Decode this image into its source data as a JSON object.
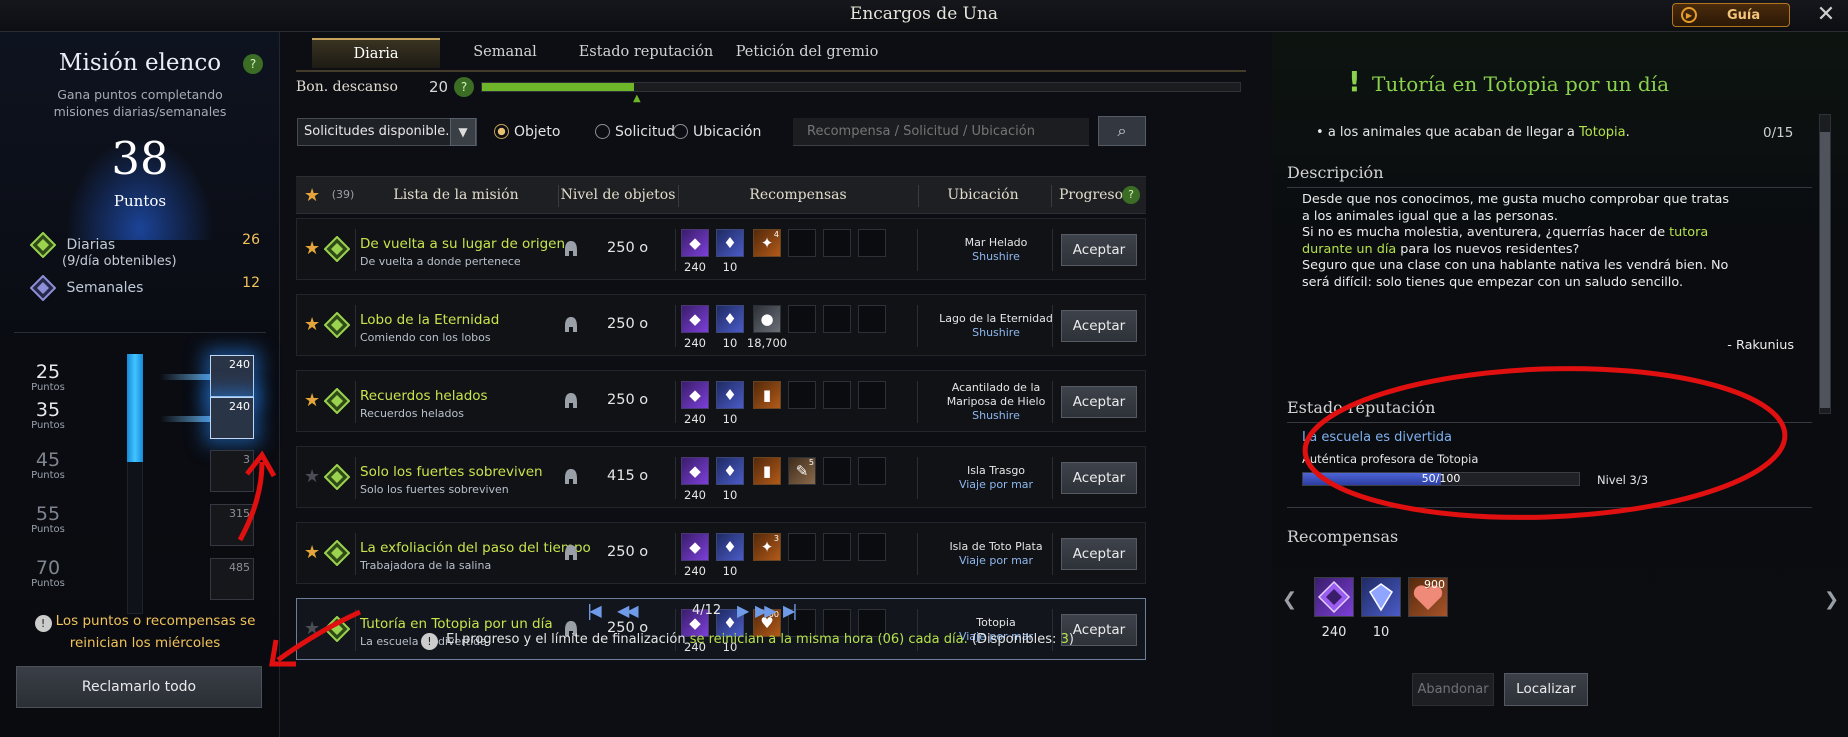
{
  "window": {
    "title": "Encargos de Una",
    "guide_label": "Guía",
    "close_glyph": "✕"
  },
  "left": {
    "title": "Misión elenco",
    "help": "?",
    "subtitle": "Gana puntos completando misiones diarias/semanales",
    "points_value": "38",
    "points_label": "Puntos",
    "daily_label": "Diarias",
    "daily_value": "26",
    "daily_note": "(9/día obtenibles)",
    "daily_note_num": "9",
    "weekly_label": "Semanales",
    "weekly_value": "12",
    "tiers": [
      {
        "points": "25",
        "unit": "Puntos",
        "reward": "240",
        "state": "claimable"
      },
      {
        "points": "35",
        "unit": "Puntos",
        "reward": "240",
        "state": "claimable"
      },
      {
        "points": "45",
        "unit": "Puntos",
        "reward": "3",
        "state": "locked"
      },
      {
        "points": "55",
        "unit": "Puntos",
        "reward": "315",
        "state": "locked"
      },
      {
        "points": "70",
        "unit": "Puntos",
        "reward": "485",
        "state": "locked"
      }
    ],
    "progress_fraction": 0.38,
    "notice": "Los puntos o recompensas se reinician los miércoles",
    "claim_all": "Reclamarlo todo"
  },
  "middle": {
    "tabs": [
      "Diaria",
      "Semanal",
      "Estado reputación",
      "Petición del gremio"
    ],
    "active_tab": "Diaria",
    "rest_label": "Bon. descanso",
    "rest_value": "20",
    "rest_help": "?",
    "rest_fraction": 0.2,
    "filter_value": "Solicitudes disponible...",
    "radios": [
      "Objeto",
      "Solicitud",
      "Ubicación"
    ],
    "radio_selected": "Objeto",
    "search_placeholder": "Recompensa / Solicitud / Ubicación",
    "headers": {
      "fav_count": "(39)",
      "mission": "Lista de la misión",
      "item_level": "Nivel de objetos",
      "rewards": "Recompensas",
      "location": "Ubicación",
      "progress": "Progreso",
      "progress_help": "?"
    },
    "rows": [
      {
        "fav": true,
        "title": "De vuelta a su lugar de origen",
        "sub": "De vuelta a donde pertenece",
        "ilvl": "250 o",
        "rewards": [
          {
            "kind": "purple",
            "qty": "240"
          },
          {
            "kind": "blue",
            "qty": "10"
          },
          {
            "kind": "orange",
            "badge": "4",
            "icon": "star-chest-icon"
          }
        ],
        "loc1": "Mar Helado",
        "loc2": "",
        "region": "Shushire",
        "accept": "Aceptar"
      },
      {
        "fav": true,
        "title": "Lobo de la Eternidad",
        "sub": "Comiendo con los lobos",
        "ilvl": "250 o",
        "rewards": [
          {
            "kind": "purple",
            "qty": "240"
          },
          {
            "kind": "blue",
            "qty": "10"
          },
          {
            "kind": "silver",
            "qty": "18,700",
            "icon": "silver-coin-icon"
          }
        ],
        "loc1": "Lago de la Eternidad",
        "loc2": "",
        "region": "Shushire",
        "accept": "Aceptar"
      },
      {
        "fav": true,
        "title": "Recuerdos helados",
        "sub": "Recuerdos helados",
        "ilvl": "250 o",
        "rewards": [
          {
            "kind": "purple",
            "qty": "240"
          },
          {
            "kind": "blue",
            "qty": "10"
          },
          {
            "kind": "orange",
            "icon": "card-pack-icon"
          }
        ],
        "loc1": "Acantilado de la",
        "loc2": "Mariposa de Hielo",
        "region": "Shushire",
        "accept": "Aceptar"
      },
      {
        "fav": false,
        "title": "Solo los fuertes sobreviven",
        "sub": "Solo los fuertes sobreviven",
        "ilvl": "415 o",
        "rewards": [
          {
            "kind": "purple",
            "qty": "240"
          },
          {
            "kind": "blue",
            "qty": "10"
          },
          {
            "kind": "orange",
            "icon": "card-pack-icon"
          },
          {
            "kind": "tan",
            "badge": "5",
            "icon": "scroll-icon"
          }
        ],
        "loc1": "Isla Trasgo",
        "loc2": "",
        "region": "Viaje por mar",
        "accept": "Aceptar"
      },
      {
        "fav": true,
        "title": "La exfoliación del paso del tiempo",
        "sub": "Trabajadora de la salina",
        "ilvl": "250 o",
        "rewards": [
          {
            "kind": "purple",
            "qty": "240"
          },
          {
            "kind": "blue",
            "qty": "10"
          },
          {
            "kind": "orange",
            "badge": "3",
            "icon": "star-chest-icon"
          }
        ],
        "loc1": "Isla de Toto Plata",
        "loc2": "",
        "region": "Viaje por mar",
        "accept": "Aceptar"
      },
      {
        "fav": false,
        "title": "Tutoría en Totopia por un día",
        "sub": "La escuela es divertida",
        "ilvl": "250 o",
        "rewards": [
          {
            "kind": "purple",
            "qty": "240"
          },
          {
            "kind": "blue",
            "qty": "10"
          },
          {
            "kind": "heart",
            "badge": "900",
            "icon": "heart-icon"
          }
        ],
        "loc1": "Totopia",
        "loc2": "",
        "region": "Viaje por mar",
        "accept": "Aceptar",
        "selected": true
      }
    ],
    "pager": {
      "page": "4/12"
    },
    "footer_a": "El progreso y el límite de finalización",
    "footer_b": "se reinician a la misma hora (06) cada día.",
    "footer_c": "(Disponibles:",
    "footer_d": "3",
    "footer_e": ")"
  },
  "right": {
    "title": "Tutoría en Totopia por un día",
    "objective_a": "a los animales que acaban de llegar a",
    "objective_b": "Totopia",
    "objective_c": ".",
    "objective_count": "0/15",
    "desc_heading": "Descripción",
    "desc": [
      {
        "t": "Desde que nos conocimos, me gusta mucho comprobar que tratas"
      },
      {
        "t": "a los animales igual que a las personas."
      },
      {
        "t": "Si no es mucha molestia, aventurera, ¿querrías hacer de ",
        "g": "tutora"
      },
      {
        "g": "durante un día",
        "t": " para los nuevos residentes?"
      },
      {
        "t": "Seguro que una clase con una hablante nativa les vendrá bien. No"
      },
      {
        "t": "será difícil: solo tienes que empezar con un saludo sencillo."
      }
    ],
    "signature": "- Rakunius",
    "rep_heading": "Estado reputación",
    "rep_name": "La escuela es divertida",
    "rep_title": "Auténtica profesora de Totopia",
    "rep_progress": "50/100",
    "rep_fraction": 0.5,
    "rep_level": "Nivel 3/3",
    "rewards_heading": "Recompensas",
    "rewards": [
      {
        "qty": "240"
      },
      {
        "qty": "10"
      },
      {
        "badge": "900"
      }
    ],
    "abandon": "Abandonar",
    "locate": "Localizar"
  },
  "colors": {
    "accent_green": "#8ad14c",
    "gold": "#f2c35a",
    "link_blue": "#7fb1ef",
    "annotation_red": "#e01010"
  }
}
